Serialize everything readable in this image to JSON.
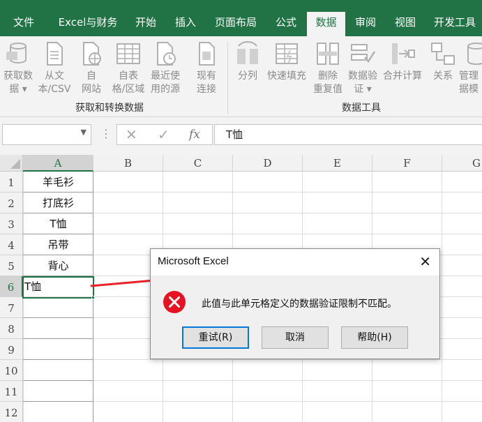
{
  "ribbon_tabs": [
    {
      "label": "文件"
    },
    {
      "label": "Excel与财务"
    },
    {
      "label": "开始"
    },
    {
      "label": "插入"
    },
    {
      "label": "页面布局"
    },
    {
      "label": "公式"
    },
    {
      "label": "数据",
      "active": true
    },
    {
      "label": "审阅"
    },
    {
      "label": "视图"
    },
    {
      "label": "开发工具"
    }
  ],
  "ribbon_groups": {
    "get_transform": {
      "label": "获取和转换数据",
      "buttons": [
        {
          "line1": "获取数",
          "line2": "据 ▾",
          "icon": "get-data-icon"
        },
        {
          "line1": "从文",
          "line2": "本/CSV",
          "icon": "from-text-icon"
        },
        {
          "line1": "自",
          "line2": "网站",
          "icon": "from-web-icon"
        },
        {
          "line1": "自表",
          "line2": "格/区域",
          "icon": "from-table-icon"
        },
        {
          "line1": "最近使",
          "line2": "用的源",
          "icon": "recent-sources-icon"
        },
        {
          "line1": "现有",
          "line2": "连接",
          "icon": "existing-connections-icon"
        }
      ]
    },
    "data_tools": {
      "label": "数据工具",
      "buttons": [
        {
          "line1": "分列",
          "line2": "",
          "icon": "text-to-columns-icon"
        },
        {
          "line1": "快速填充",
          "line2": "",
          "icon": "flash-fill-icon"
        },
        {
          "line1": "删除",
          "line2": "重复值",
          "icon": "remove-duplicates-icon"
        },
        {
          "line1": "数据验",
          "line2": "证 ▾",
          "icon": "data-validation-icon"
        },
        {
          "line1": "合并计算",
          "line2": "",
          "icon": "consolidate-icon"
        },
        {
          "line1": "关系",
          "line2": "",
          "icon": "relationships-icon"
        },
        {
          "line1": "管理",
          "line2": "据模",
          "icon": "data-model-icon"
        }
      ]
    }
  },
  "formula_bar": {
    "name_box": "",
    "cancel_glyph": "✕",
    "enter_glyph": "✓",
    "fx_label": "fx",
    "content": "T恤"
  },
  "sheet": {
    "columns": [
      "A",
      "B",
      "C",
      "D",
      "E",
      "F",
      "G"
    ],
    "rows": [
      "1",
      "2",
      "3",
      "4",
      "5",
      "6",
      "7",
      "8",
      "9",
      "10",
      "11",
      "12"
    ],
    "column_a_values": [
      "羊毛衫",
      "打底衫",
      "T恤",
      "吊带",
      "背心"
    ],
    "active_cell_value": "T恤"
  },
  "dialog": {
    "title": "Microsoft Excel",
    "message": "此值与此单元格定义的数据验证限制不匹配。",
    "buttons": [
      "重试(R)",
      "取消",
      "帮助(H)"
    ]
  },
  "colors": {
    "ribbon_green": "#217346",
    "error_red": "#e81123",
    "arrow_red": "#e8212b",
    "default_button_border": "#0078d7"
  }
}
